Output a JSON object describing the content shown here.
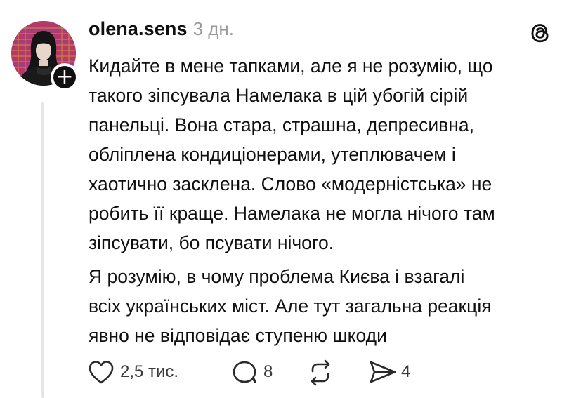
{
  "post": {
    "username": "olena.sens",
    "timestamp": "3 дн.",
    "paragraphs": [
      "Кидайте в мене тапками, але я не розумію, що\nтакого зіпсувала Намелака в цій убогій сірій\nпанельці. Вона стара, страшна, депресивна,\nобліплена кондиціонерами, утеплювачем і\nхаотично засклена. Слово «модерністська» не\nробить її краще. Намелака не могла нічого там\nзіпсувати, бо псувати нічого.",
      "Я розумію, в чому проблема Києва і взагалі\nвсіх українських міст. Але тут загальна реакція\nявно не відповідає ступеню шкоди"
    ],
    "follow_symbol": "+"
  },
  "actions": {
    "likes": "2,5 тис.",
    "replies": "8",
    "reposts": "",
    "shares": "4"
  },
  "icons": {
    "avatar": "profile-photo",
    "follow": "plus-icon",
    "logo": "threads-logo-icon",
    "like": "heart-icon",
    "reply": "comment-icon",
    "repost": "repost-icon",
    "share": "send-icon"
  },
  "colors": {
    "text": "#101010",
    "muted": "#9a9a9a",
    "thread_line": "#e6e6e6"
  }
}
